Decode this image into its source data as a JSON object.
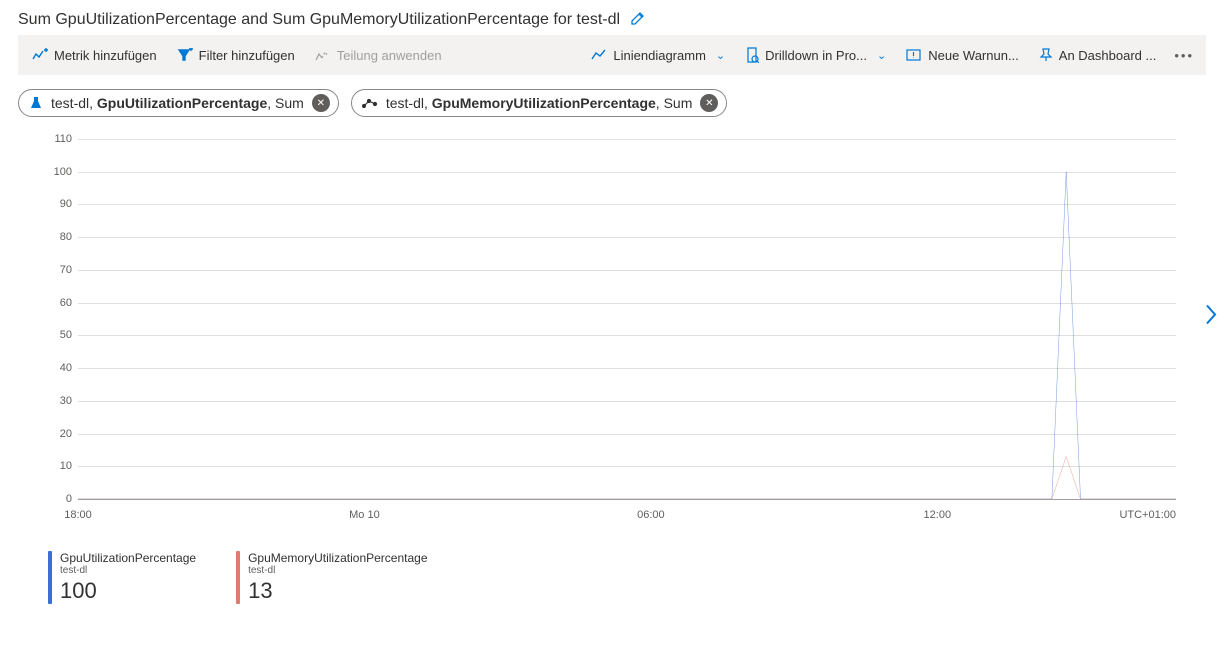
{
  "title": "Sum GpuUtilizationPercentage and Sum GpuMemoryUtilizationPercentage for test-dl",
  "toolbar": {
    "add_metric": "Metrik hinzufügen",
    "add_filter": "Filter hinzufügen",
    "apply_split": "Teilung anwenden",
    "chart_type": "Liniendiagramm",
    "drilldown": "Drilldown in Pro...",
    "new_alert": "Neue Warnun...",
    "pin_dashboard": "An Dashboard ..."
  },
  "pills": [
    {
      "resource": "test-dl",
      "metric": "GpuUtilizationPercentage",
      "agg": "Sum",
      "icon": "flask"
    },
    {
      "resource": "test-dl",
      "metric": "GpuMemoryUtilizationPercentage",
      "agg": "Sum",
      "icon": "dots"
    }
  ],
  "chart_data": {
    "type": "line",
    "ylim": [
      0,
      110
    ],
    "yticks": [
      0,
      10,
      20,
      30,
      40,
      50,
      60,
      70,
      80,
      90,
      100,
      110
    ],
    "xlabel": "",
    "xticks": [
      {
        "label": "18:00",
        "t": 0
      },
      {
        "label": "Mo 10",
        "t": 6
      },
      {
        "label": "06:00",
        "t": 12
      },
      {
        "label": "12:00",
        "t": 18
      }
    ],
    "tz_label": "UTC+01:00",
    "x_range_hours": 23,
    "series": [
      {
        "name": "GpuUtilizationPercentage",
        "resource": "test-dl",
        "color": "#3b6fd6",
        "peak_value": 100,
        "data": [
          {
            "t": 0,
            "y": 0
          },
          {
            "t": 20.4,
            "y": 0
          },
          {
            "t": 20.7,
            "y": 100
          },
          {
            "t": 21.0,
            "y": 0
          },
          {
            "t": 23,
            "y": 0
          }
        ]
      },
      {
        "name": "GpuMemoryUtilizationPercentage",
        "resource": "test-dl",
        "color": "#e07b6f",
        "peak_value": 13,
        "data": [
          {
            "t": 0,
            "y": 0
          },
          {
            "t": 20.4,
            "y": 0
          },
          {
            "t": 20.7,
            "y": 13
          },
          {
            "t": 21.0,
            "y": 0
          },
          {
            "t": 23,
            "y": 0
          }
        ]
      }
    ]
  },
  "legend": [
    {
      "name": "GpuUtilizationPercentage",
      "resource": "test-dl",
      "value": "100",
      "color": "#3b6fd6"
    },
    {
      "name": "GpuMemoryUtilizationPercentage",
      "resource": "test-dl",
      "value": "13",
      "color": "#e07b6f"
    }
  ]
}
